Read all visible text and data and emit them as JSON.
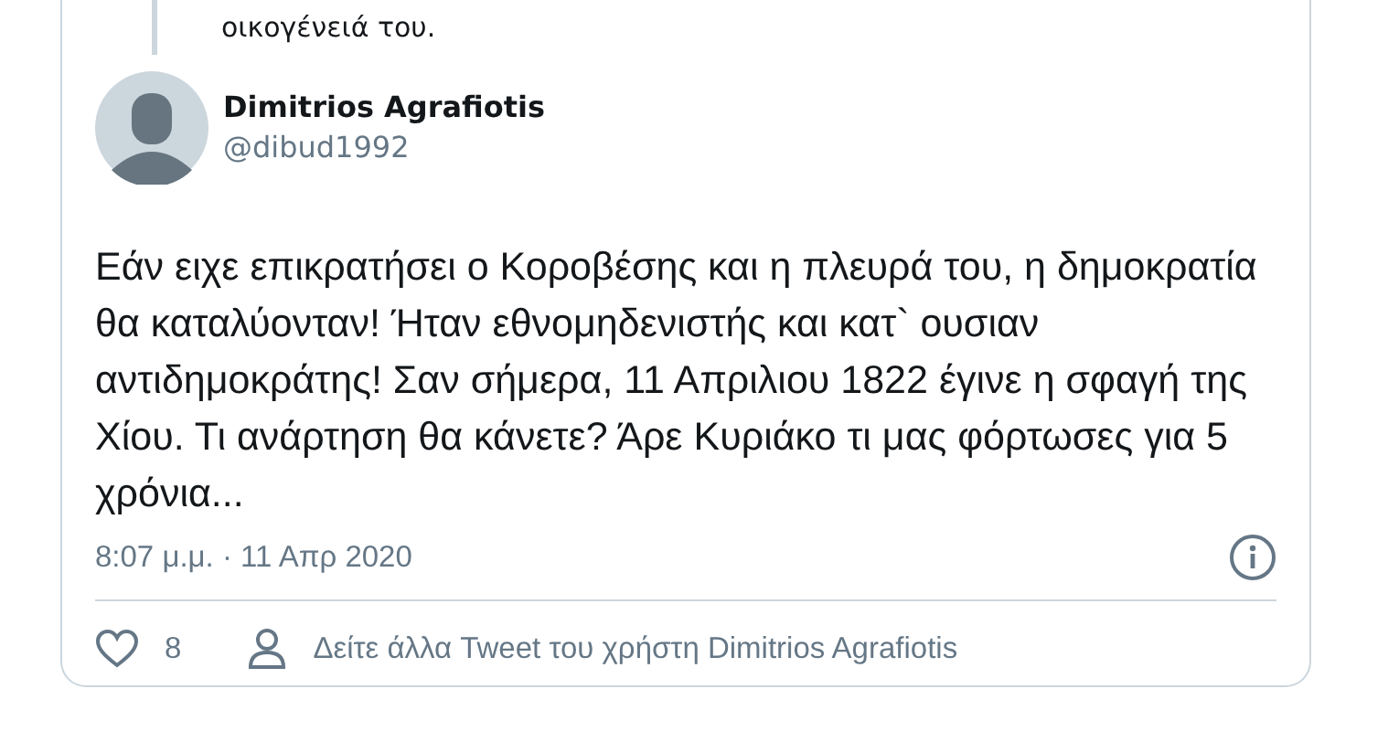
{
  "quoted_tweet": {
    "text": "οικογένειά του."
  },
  "tweet": {
    "author": {
      "name": "Dimitrios Agrafiotis",
      "handle": "@dibud1992"
    },
    "text": "Εάν ειχε επικρατήσει ο Κοροβέσης και η πλευρά του, η δημοκρατία θα καταλύονταν! Ήταν εθνομηδενιστής και κατ` ουσιαν αντιδημοκράτης! Σαν σήμερα, 11 Απριλιου 1822 έγινε η σφαγή της Χίου. Τι ανάρτηση θα κάνετε? Άρε Κυριάκο τι μας φόρτωσες για 5 χρόνια...",
    "timestamp": "8:07 μ.μ. · 11 Απρ 2020",
    "likes": "8",
    "more_link": "Δείτε άλλα Tweet του χρήστη Dimitrios Agrafiotis"
  }
}
